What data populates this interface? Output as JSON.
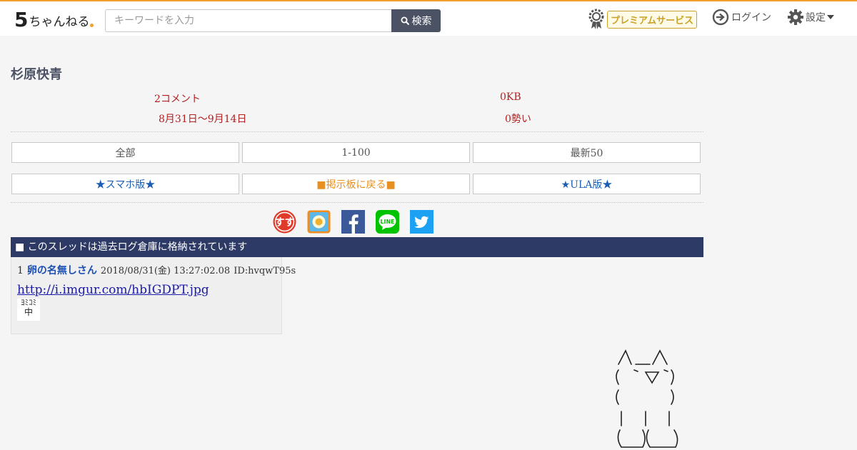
{
  "header": {
    "logo_number": "5",
    "logo_text": "ちゃんねる",
    "search_placeholder": "キーワードを入力",
    "search_button": "検索",
    "premium_label": "プレミアムサービス",
    "login_label": "ログイン",
    "settings_label": "設定",
    "accent_color": "#f0a030"
  },
  "thread": {
    "title": "杉原快青",
    "comments": "2コメント",
    "size": "0KB",
    "period": "8月31日〜9月14日",
    "momentum": "0勢い"
  },
  "nav": {
    "all": "全部",
    "range": "1-100",
    "latest": "最新50",
    "smartphone": "★スマホ版★",
    "back_to_board": "■掲示板に戻る■",
    "ula": "★ULA版★"
  },
  "share_icons": [
    "sugoi-icon",
    "ranking-icon",
    "facebook-icon",
    "line-icon",
    "twitter-icon"
  ],
  "notice": "■ このスレッドは過去ログ倉庫に格納されています",
  "posts": [
    {
      "number": "1",
      "name": "卵の名無しさん",
      "date": "2018/08/31(金) 13:27:02.08",
      "id": "ID:hvqwT95s",
      "link": "http://i.imgur.com/hbIGDPT.jpg",
      "thumb_text_top": "ﾖﾐｺﾐ",
      "thumb_text_bottom": "中"
    }
  ]
}
